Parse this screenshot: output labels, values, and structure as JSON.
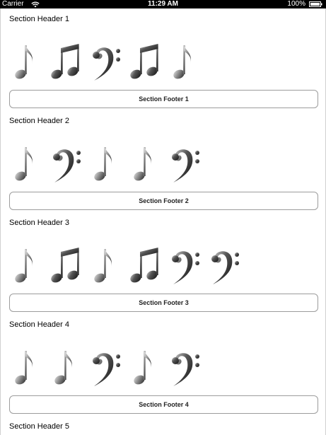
{
  "status_bar": {
    "carrier": "Carrier",
    "time": "11:29 AM",
    "battery": "100%"
  },
  "sections": [
    {
      "header": "Section Header 1",
      "footer": "Section Footer 1",
      "icons": [
        "eighth-note-icon",
        "beamed-notes-icon",
        "bass-clef-icon",
        "beamed-notes-icon",
        "eighth-note-icon"
      ]
    },
    {
      "header": "Section Header 2",
      "footer": "Section Footer 2",
      "icons": [
        "eighth-note-icon",
        "bass-clef-icon",
        "eighth-note-icon",
        "eighth-note-icon",
        "bass-clef-icon"
      ]
    },
    {
      "header": "Section Header 3",
      "footer": "Section Footer 3",
      "icons": [
        "eighth-note-icon",
        "beamed-notes-icon",
        "eighth-note-icon",
        "beamed-notes-icon",
        "bass-clef-icon",
        "bass-clef-icon"
      ]
    },
    {
      "header": "Section Header 4",
      "footer": "Section Footer 4",
      "icons": [
        "eighth-note-icon",
        "eighth-note-icon",
        "bass-clef-icon",
        "eighth-note-icon",
        "bass-clef-icon"
      ]
    },
    {
      "header": "Section Header 5"
    }
  ]
}
